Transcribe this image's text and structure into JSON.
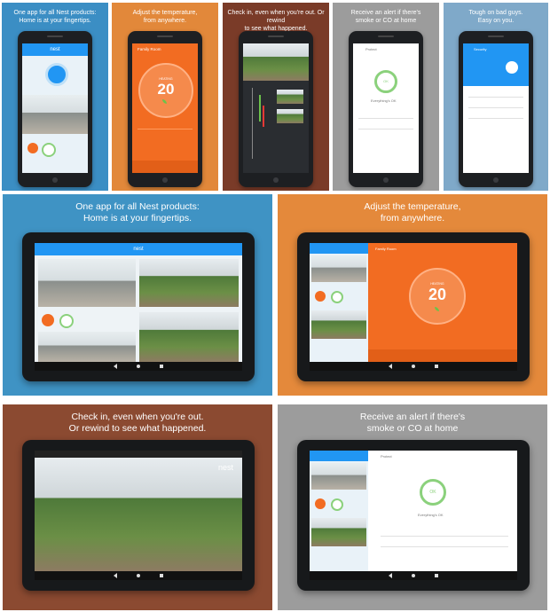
{
  "tiles_top": [
    {
      "caption": "One app for all Nest products:\nHome is at your fingertips.",
      "bg": "#3b8ec4"
    },
    {
      "caption": "Adjust the temperature,\nfrom anywhere.",
      "bg": "#e2883a"
    },
    {
      "caption": "Check in, even when you're out. Or rewind\nto see what happened.",
      "bg": "#7a3b28"
    },
    {
      "caption": "Receive an alert if there's\nsmoke or CO at home",
      "bg": "#9c9c9c"
    },
    {
      "caption": "Tough on bad guys.\nEasy on you.",
      "bg": "#7fa9c9"
    }
  ],
  "tiles_mid": [
    {
      "caption": "One app for all Nest products:\nHome is at your fingertips.",
      "bg": "#3f93c4"
    },
    {
      "caption": "Adjust the temperature,\nfrom anywhere.",
      "bg": "#e4893b"
    }
  ],
  "tiles_bot": [
    {
      "caption": "Check in, even when you're out.\nOr rewind to see what happened.",
      "bg": "#8b4a31"
    },
    {
      "caption": "Receive an alert if there's\nsmoke or CO at home",
      "bg": "#9c9c9c"
    }
  ],
  "app": {
    "brand": "nest",
    "family_room": "Family Room",
    "heating": "HEATING",
    "target_temp": "20",
    "protect": "Protect",
    "security": "Security",
    "everything_ok": "Everything's OK",
    "ok_label": "OK"
  },
  "colors": {
    "nest_blue": "#2196f3",
    "thermo_orange": "#f26c22",
    "protect_green": "#8bd17c"
  }
}
